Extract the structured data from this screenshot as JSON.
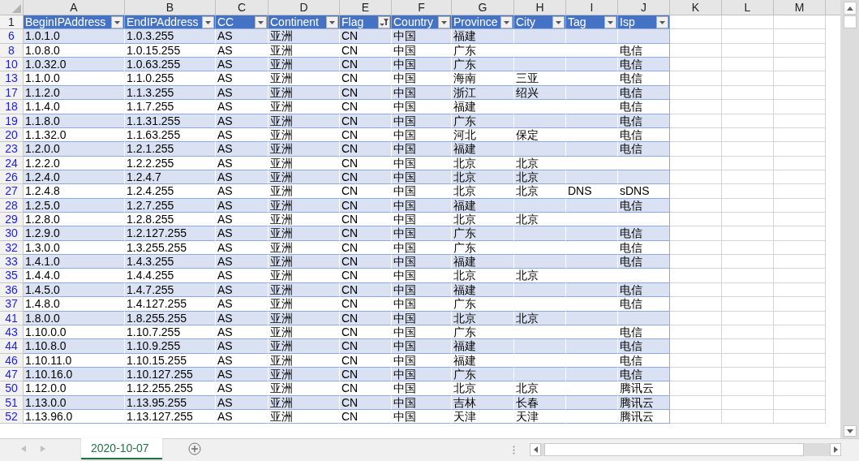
{
  "columns": [
    {
      "letter": "A",
      "header": "BeginIPAddress",
      "filter_applied": false
    },
    {
      "letter": "B",
      "header": "EndIPAddress",
      "filter_applied": false
    },
    {
      "letter": "C",
      "header": "CC",
      "filter_applied": false
    },
    {
      "letter": "D",
      "header": "Continent",
      "filter_applied": false
    },
    {
      "letter": "E",
      "header": "Flag",
      "filter_applied": true
    },
    {
      "letter": "F",
      "header": "Country",
      "filter_applied": false
    },
    {
      "letter": "G",
      "header": "Province",
      "filter_applied": false
    },
    {
      "letter": "H",
      "header": "City",
      "filter_applied": false
    },
    {
      "letter": "I",
      "header": "Tag",
      "filter_applied": false
    },
    {
      "letter": "J",
      "header": "Isp",
      "filter_applied": false
    }
  ],
  "extra_columns": [
    "K",
    "L",
    "M"
  ],
  "header_row_number": "1",
  "rows": [
    {
      "row_number": "6",
      "cells": {
        "A": "1.0.1.0",
        "B": "1.0.3.255",
        "C": "AS",
        "D": "亚洲",
        "E": "CN",
        "F": "中国",
        "G": "福建"
      }
    },
    {
      "row_number": "8",
      "cells": {
        "A": "1.0.8.0",
        "B": "1.0.15.255",
        "C": "AS",
        "D": "亚洲",
        "E": "CN",
        "F": "中国",
        "G": "广东",
        "J": "电信"
      }
    },
    {
      "row_number": "10",
      "cells": {
        "A": "1.0.32.0",
        "B": "1.0.63.255",
        "C": "AS",
        "D": "亚洲",
        "E": "CN",
        "F": "中国",
        "G": "广东",
        "J": "电信"
      }
    },
    {
      "row_number": "13",
      "cells": {
        "A": "1.1.0.0",
        "B": "1.1.0.255",
        "C": "AS",
        "D": "亚洲",
        "E": "CN",
        "F": "中国",
        "G": "海南",
        "H": "三亚",
        "J": "电信"
      }
    },
    {
      "row_number": "17",
      "cells": {
        "A": "1.1.2.0",
        "B": "1.1.3.255",
        "C": "AS",
        "D": "亚洲",
        "E": "CN",
        "F": "中国",
        "G": "浙江",
        "H": "绍兴",
        "J": "电信"
      }
    },
    {
      "row_number": "18",
      "cells": {
        "A": "1.1.4.0",
        "B": "1.1.7.255",
        "C": "AS",
        "D": "亚洲",
        "E": "CN",
        "F": "中国",
        "G": "福建",
        "J": "电信"
      }
    },
    {
      "row_number": "19",
      "cells": {
        "A": "1.1.8.0",
        "B": "1.1.31.255",
        "C": "AS",
        "D": "亚洲",
        "E": "CN",
        "F": "中国",
        "G": "广东",
        "J": "电信"
      }
    },
    {
      "row_number": "20",
      "cells": {
        "A": "1.1.32.0",
        "B": "1.1.63.255",
        "C": "AS",
        "D": "亚洲",
        "E": "CN",
        "F": "中国",
        "G": "河北",
        "H": "保定",
        "J": "电信"
      }
    },
    {
      "row_number": "23",
      "cells": {
        "A": "1.2.0.0",
        "B": "1.2.1.255",
        "C": "AS",
        "D": "亚洲",
        "E": "CN",
        "F": "中国",
        "G": "福建",
        "J": "电信"
      }
    },
    {
      "row_number": "24",
      "cells": {
        "A": "1.2.2.0",
        "B": "1.2.2.255",
        "C": "AS",
        "D": "亚洲",
        "E": "CN",
        "F": "中国",
        "G": "北京",
        "H": "北京"
      }
    },
    {
      "row_number": "26",
      "cells": {
        "A": "1.2.4.0",
        "B": "1.2.4.7",
        "C": "AS",
        "D": "亚洲",
        "E": "CN",
        "F": "中国",
        "G": "北京",
        "H": "北京"
      }
    },
    {
      "row_number": "27",
      "cells": {
        "A": "1.2.4.8",
        "B": "1.2.4.255",
        "C": "AS",
        "D": "亚洲",
        "E": "CN",
        "F": "中国",
        "G": "北京",
        "H": "北京",
        "I": "DNS",
        "J": "sDNS"
      }
    },
    {
      "row_number": "28",
      "cells": {
        "A": "1.2.5.0",
        "B": "1.2.7.255",
        "C": "AS",
        "D": "亚洲",
        "E": "CN",
        "F": "中国",
        "G": "福建",
        "J": "电信"
      }
    },
    {
      "row_number": "29",
      "cells": {
        "A": "1.2.8.0",
        "B": "1.2.8.255",
        "C": "AS",
        "D": "亚洲",
        "E": "CN",
        "F": "中国",
        "G": "北京",
        "H": "北京"
      }
    },
    {
      "row_number": "30",
      "cells": {
        "A": "1.2.9.0",
        "B": "1.2.127.255",
        "C": "AS",
        "D": "亚洲",
        "E": "CN",
        "F": "中国",
        "G": "广东",
        "J": "电信"
      }
    },
    {
      "row_number": "32",
      "cells": {
        "A": "1.3.0.0",
        "B": "1.3.255.255",
        "C": "AS",
        "D": "亚洲",
        "E": "CN",
        "F": "中国",
        "G": "广东",
        "J": "电信"
      }
    },
    {
      "row_number": "33",
      "cells": {
        "A": "1.4.1.0",
        "B": "1.4.3.255",
        "C": "AS",
        "D": "亚洲",
        "E": "CN",
        "F": "中国",
        "G": "福建",
        "J": "电信"
      }
    },
    {
      "row_number": "35",
      "cells": {
        "A": "1.4.4.0",
        "B": "1.4.4.255",
        "C": "AS",
        "D": "亚洲",
        "E": "CN",
        "F": "中国",
        "G": "北京",
        "H": "北京"
      }
    },
    {
      "row_number": "36",
      "cells": {
        "A": "1.4.5.0",
        "B": "1.4.7.255",
        "C": "AS",
        "D": "亚洲",
        "E": "CN",
        "F": "中国",
        "G": "福建",
        "J": "电信"
      }
    },
    {
      "row_number": "37",
      "cells": {
        "A": "1.4.8.0",
        "B": "1.4.127.255",
        "C": "AS",
        "D": "亚洲",
        "E": "CN",
        "F": "中国",
        "G": "广东",
        "J": "电信"
      }
    },
    {
      "row_number": "41",
      "cells": {
        "A": "1.8.0.0",
        "B": "1.8.255.255",
        "C": "AS",
        "D": "亚洲",
        "E": "CN",
        "F": "中国",
        "G": "北京",
        "H": "北京"
      }
    },
    {
      "row_number": "43",
      "cells": {
        "A": "1.10.0.0",
        "B": "1.10.7.255",
        "C": "AS",
        "D": "亚洲",
        "E": "CN",
        "F": "中国",
        "G": "广东",
        "J": "电信"
      }
    },
    {
      "row_number": "44",
      "cells": {
        "A": "1.10.8.0",
        "B": "1.10.9.255",
        "C": "AS",
        "D": "亚洲",
        "E": "CN",
        "F": "中国",
        "G": "福建",
        "J": "电信"
      }
    },
    {
      "row_number": "46",
      "cells": {
        "A": "1.10.11.0",
        "B": "1.10.15.255",
        "C": "AS",
        "D": "亚洲",
        "E": "CN",
        "F": "中国",
        "G": "福建",
        "J": "电信"
      }
    },
    {
      "row_number": "47",
      "cells": {
        "A": "1.10.16.0",
        "B": "1.10.127.255",
        "C": "AS",
        "D": "亚洲",
        "E": "CN",
        "F": "中国",
        "G": "广东",
        "J": "电信"
      }
    },
    {
      "row_number": "50",
      "cells": {
        "A": "1.12.0.0",
        "B": "1.12.255.255",
        "C": "AS",
        "D": "亚洲",
        "E": "CN",
        "F": "中国",
        "G": "北京",
        "H": "北京",
        "J": "腾讯云"
      }
    },
    {
      "row_number": "51",
      "cells": {
        "A": "1.13.0.0",
        "B": "1.13.95.255",
        "C": "AS",
        "D": "亚洲",
        "E": "CN",
        "F": "中国",
        "G": "吉林",
        "H": "长春",
        "J": "腾讯云"
      }
    },
    {
      "row_number": "52",
      "cells": {
        "A": "1.13.96.0",
        "B": "1.13.127.255",
        "C": "AS",
        "D": "亚洲",
        "E": "CN",
        "F": "中国",
        "G": "天津",
        "H": "天津",
        "J": "腾讯云"
      }
    }
  ],
  "sheet_tabs": [
    {
      "label": "2020-10-07",
      "selected": true
    }
  ]
}
